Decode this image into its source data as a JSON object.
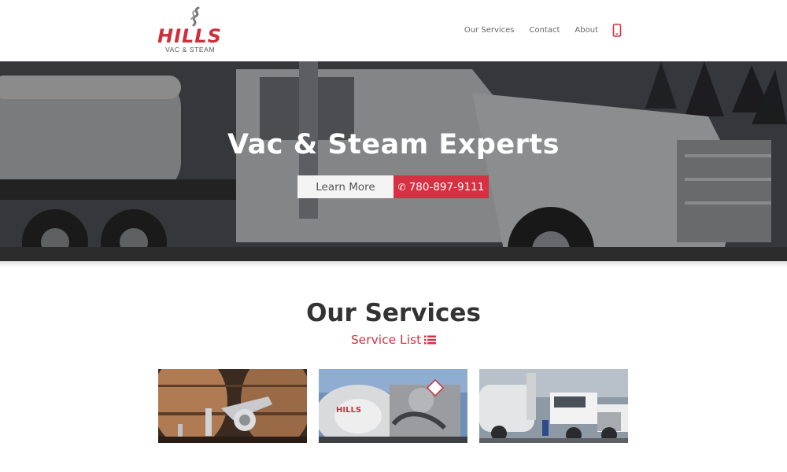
{
  "brand": {
    "name": "HILLS",
    "tagline": "VAC & STEAM",
    "accent_color": "#d63142"
  },
  "nav": {
    "items": [
      {
        "label": "Our Services"
      },
      {
        "label": "Contact"
      },
      {
        "label": "About"
      }
    ],
    "phone_icon": "mobile-phone-icon"
  },
  "hero": {
    "title": "Vac & Steam Experts",
    "learn_more_label": "Learn More",
    "phone_label": "780-897-9111",
    "phone_icon": "phone-icon"
  },
  "services": {
    "title": "Our Services",
    "list_label": "Service List",
    "list_icon": "list-icon",
    "cards": [
      {
        "subject": "barrel-steam-valve"
      },
      {
        "subject": "vac-truck-tank"
      },
      {
        "subject": "vac-truck-fleet"
      }
    ]
  }
}
